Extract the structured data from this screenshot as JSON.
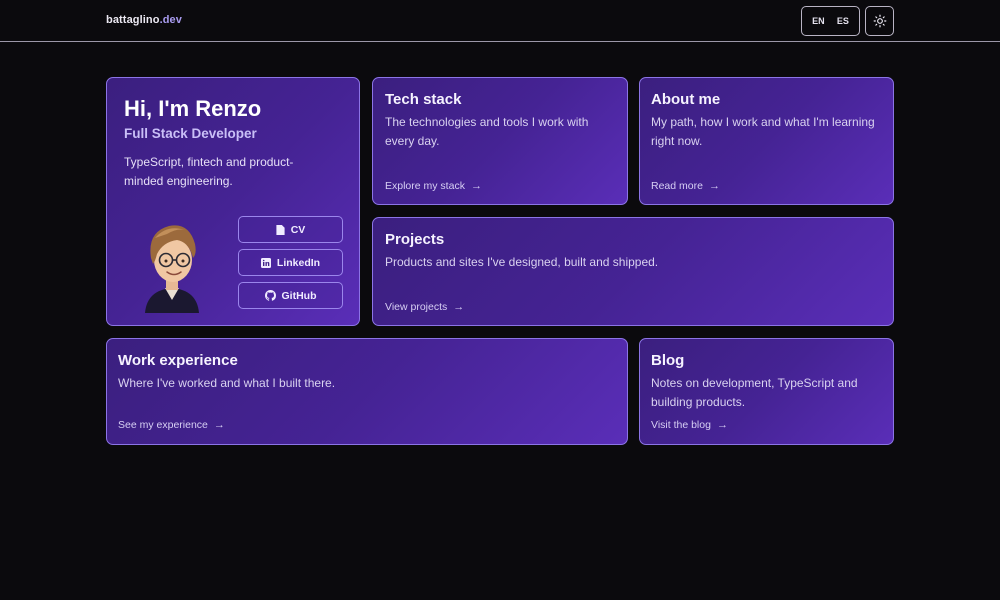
{
  "header": {
    "brand_name": "battaglino",
    "brand_tld": ".dev",
    "lang_en": "EN",
    "lang_es": "ES"
  },
  "hero": {
    "title": "Hi, I'm Renzo",
    "subtitle": "Full Stack Developer",
    "description_line1": "TypeScript, fintech and product-",
    "description_line2": "minded engineering.",
    "cv_label": "CV",
    "linkedin_label": "LinkedIn",
    "github_label": "GitHub"
  },
  "tech": {
    "title": "Tech stack",
    "description": "The technologies and tools I work with every day.",
    "link": "Explore my stack"
  },
  "about": {
    "title": "About me",
    "description": "My path, how I work and what I'm learning right now.",
    "link": "Read more"
  },
  "projects": {
    "title": "Projects",
    "description": "Products and sites I've designed, built and shipped.",
    "link": "View projects"
  },
  "work": {
    "title": "Work experience",
    "description": "Where I've worked and what I built there.",
    "link": "See my experience"
  },
  "blog": {
    "title": "Blog",
    "description": "Notes on development, TypeScript and building products.",
    "link": "Visit the blog"
  },
  "arrow": "→",
  "colors": {
    "background": "#0b0a0d",
    "card_border": "#8c74e6",
    "card_gradient_start": "#3b1f7f",
    "card_gradient_end": "#5a2eb8",
    "accent": "#a99cf0"
  }
}
